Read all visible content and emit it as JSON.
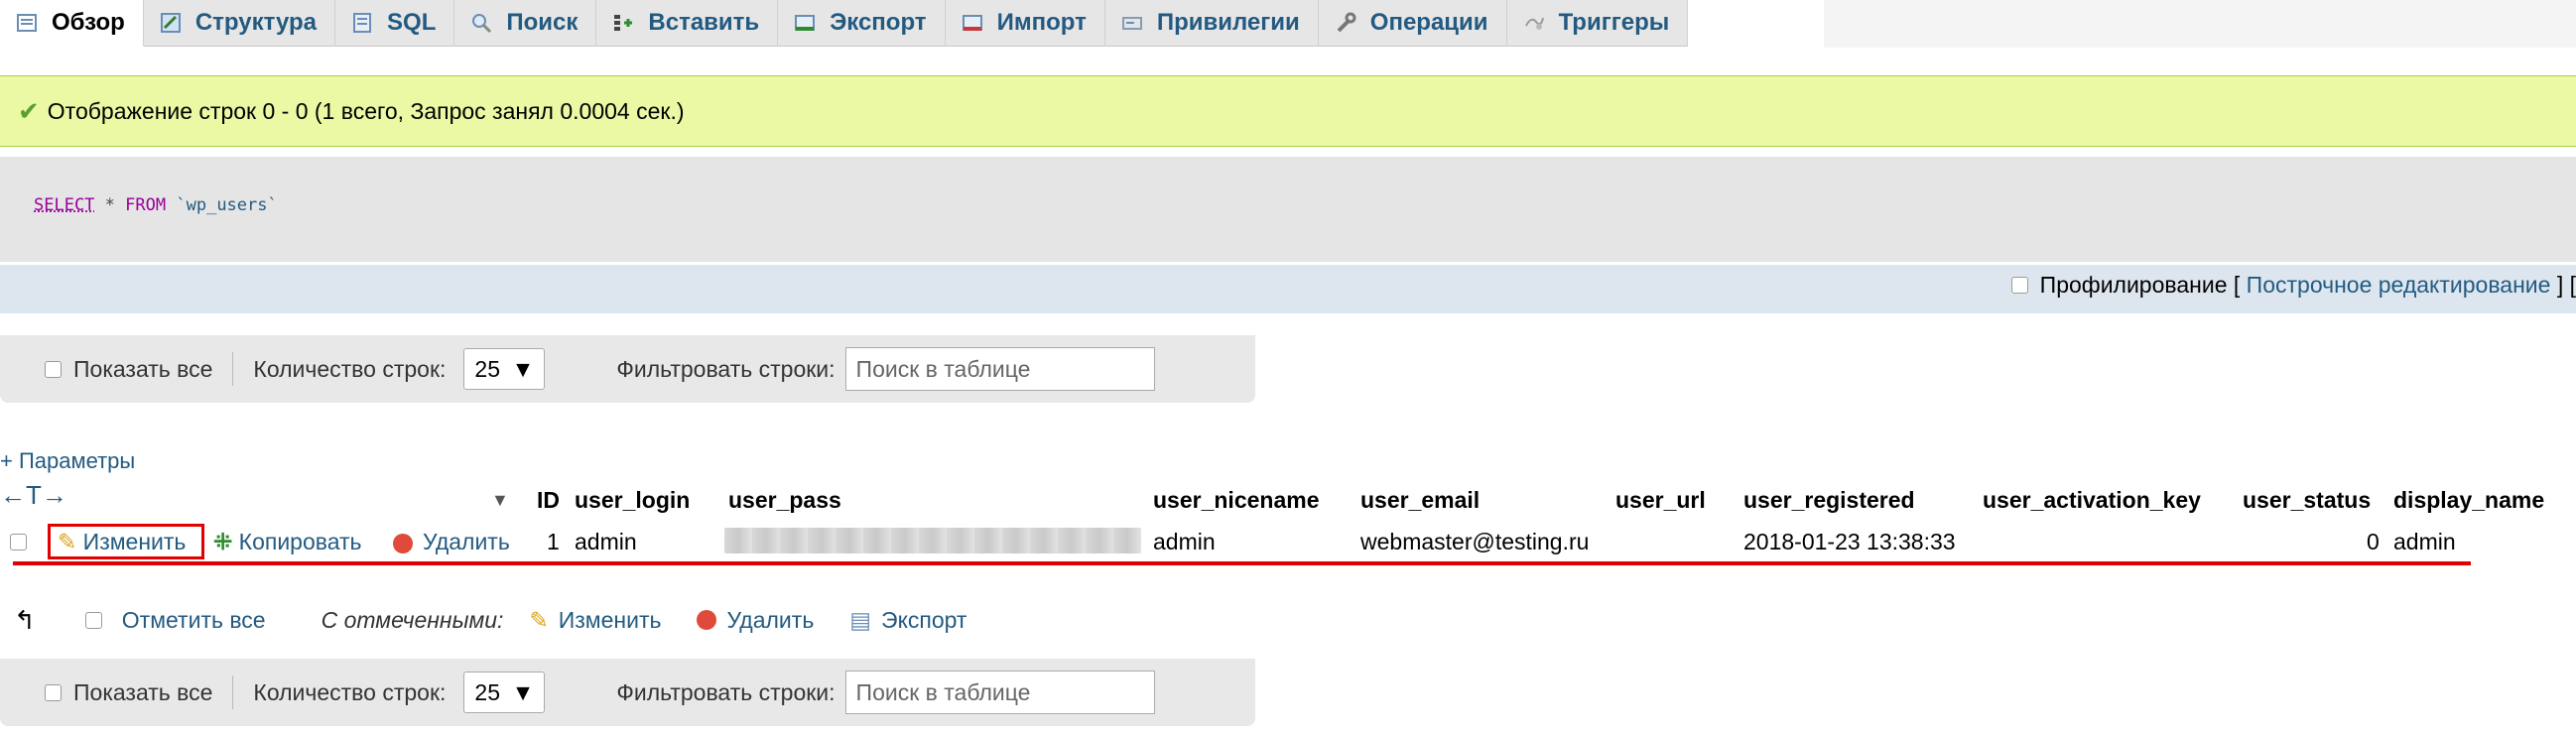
{
  "tabs": [
    {
      "label": "Обзор",
      "icon": "browse-icon",
      "active": true
    },
    {
      "label": "Структура",
      "icon": "structure-icon"
    },
    {
      "label": "SQL",
      "icon": "sql-icon"
    },
    {
      "label": "Поиск",
      "icon": "search-icon"
    },
    {
      "label": "Вставить",
      "icon": "insert-icon"
    },
    {
      "label": "Экспорт",
      "icon": "export-icon"
    },
    {
      "label": "Импорт",
      "icon": "import-icon"
    },
    {
      "label": "Привилегии",
      "icon": "privileges-icon"
    },
    {
      "label": "Операции",
      "icon": "operations-icon"
    },
    {
      "label": "Триггеры",
      "icon": "triggers-icon"
    }
  ],
  "success_message": "Отображение строк 0 - 0 (1 всего, Запрос занял 0.0004 сек.)",
  "sql": {
    "select": "SELECT",
    "star": "*",
    "from": "FROM",
    "table": "`wp_users`"
  },
  "profiling": {
    "label": "Профилирование",
    "bracket_open": "[",
    "inline_edit": "Построчное редактирование",
    "bracket_close": "] ["
  },
  "nav": {
    "show_all": "Показать все",
    "rows_label": "Количество строк:",
    "rows_value": "25",
    "filter_label": "Фильтровать строки:",
    "filter_placeholder": "Поиск в таблице"
  },
  "params_label": "+ Параметры",
  "arrows": "←T→",
  "columns": [
    "ID",
    "user_login",
    "user_pass",
    "user_nicename",
    "user_email",
    "user_url",
    "user_registered",
    "user_activation_key",
    "user_status",
    "display_name"
  ],
  "row": {
    "edit": "Изменить",
    "copy": "Копировать",
    "delete": "Удалить",
    "ID": "1",
    "user_login": "admin",
    "user_nicename": "admin",
    "user_email": "webmaster@testing.ru",
    "user_url": "",
    "user_registered": "2018-01-23 13:38:33",
    "user_activation_key": "",
    "user_status": "0",
    "display_name": "admin"
  },
  "bulk": {
    "check_all": "Отметить все",
    "with_selected": "С отмеченными:",
    "edit": "Изменить",
    "delete": "Удалить",
    "export": "Экспорт"
  },
  "colors": {
    "link": "#235a81",
    "success_bg": "#ebf8a4",
    "highlight": "#e30000"
  }
}
